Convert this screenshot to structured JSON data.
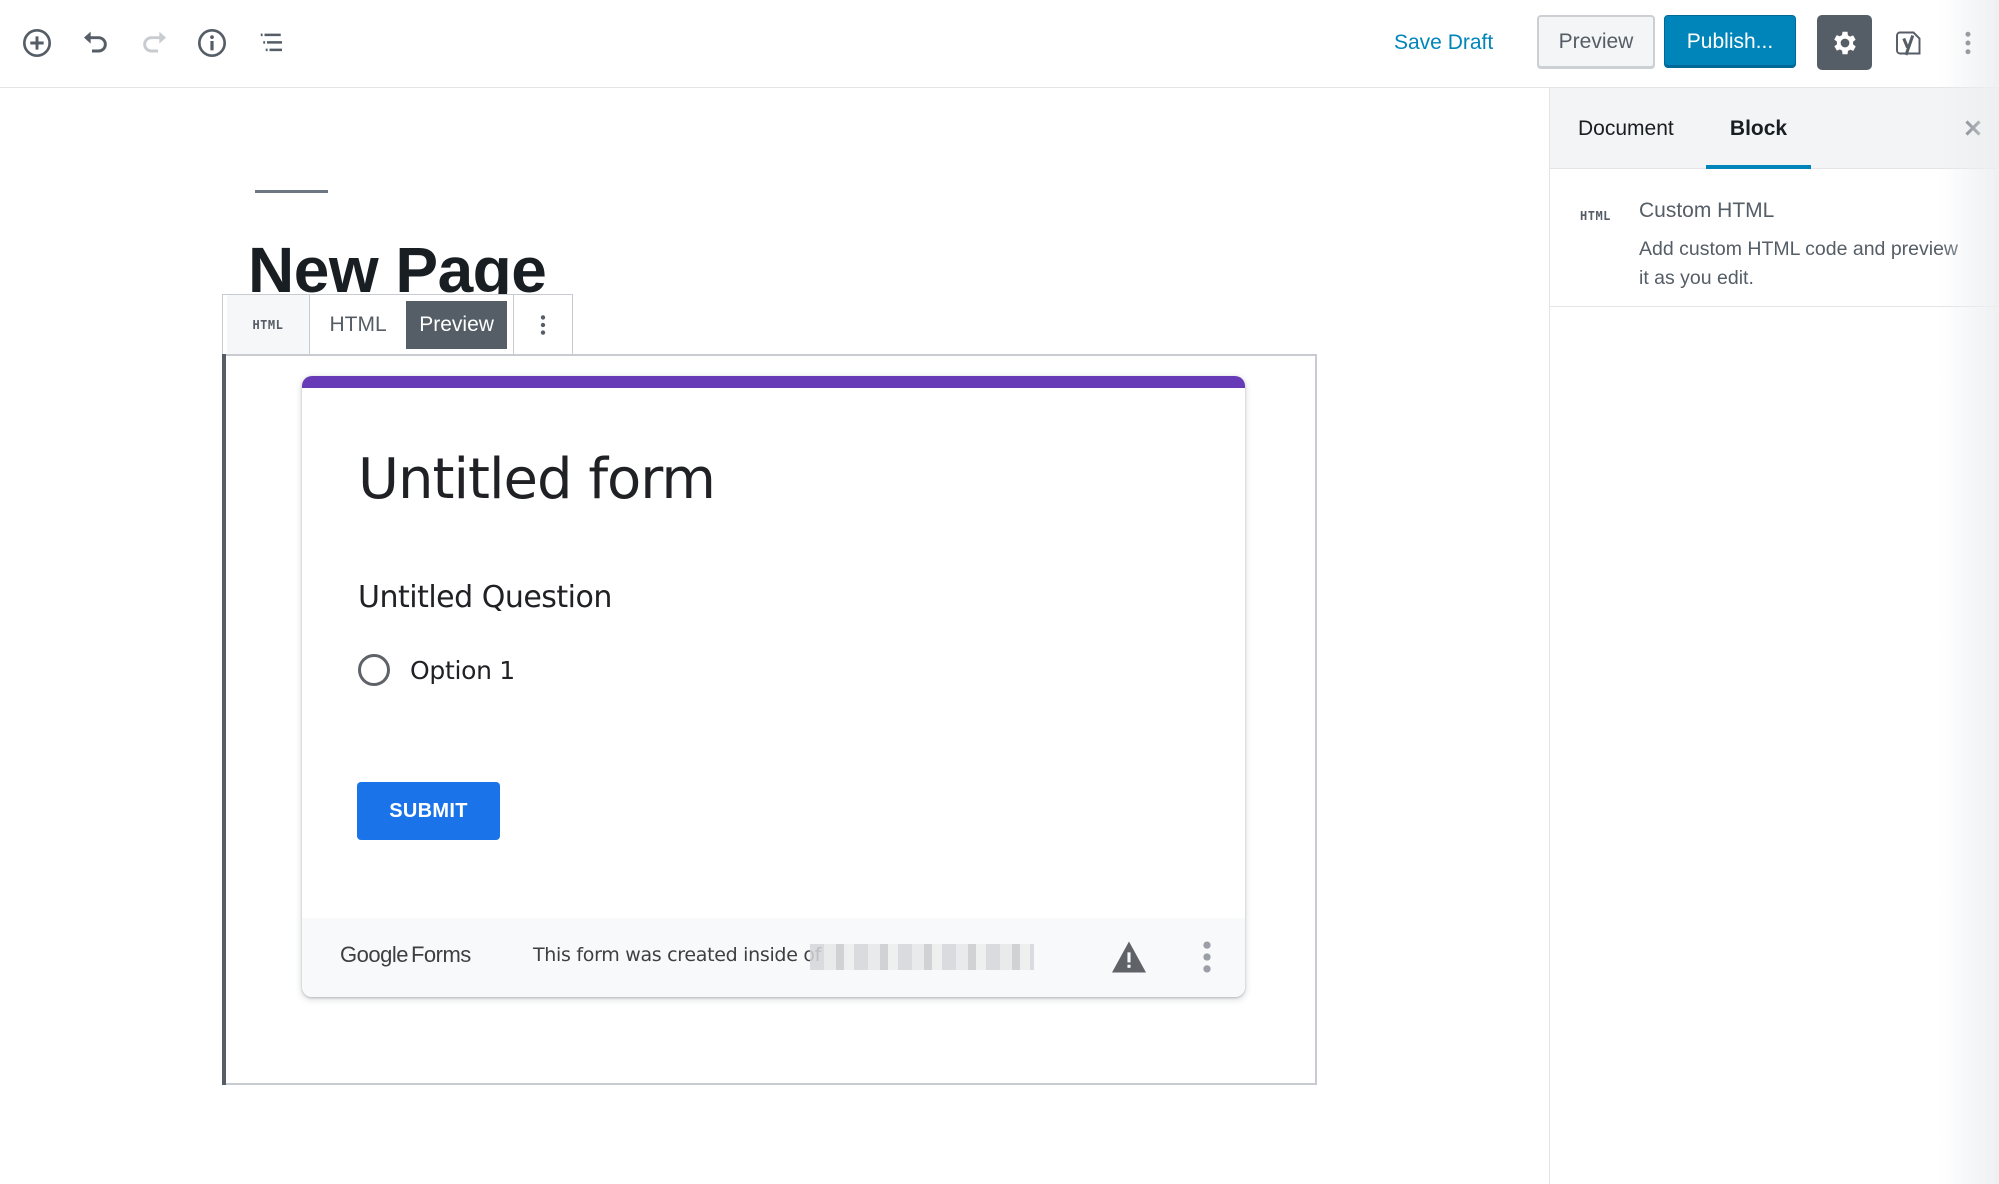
{
  "header": {
    "toolbar_icons": [
      {
        "name": "add-block-icon",
        "label": "Add block"
      },
      {
        "name": "undo-icon",
        "label": "Undo"
      },
      {
        "name": "redo-icon",
        "label": "Redo",
        "disabled": true
      },
      {
        "name": "info-icon",
        "label": "Content structure"
      },
      {
        "name": "block-navigation-icon",
        "label": "Block navigation"
      }
    ],
    "save_draft_label": "Save Draft",
    "preview_label": "Preview",
    "publish_label": "Publish...",
    "settings_icon": "gear-icon",
    "yoast_icon": "yoast-icon",
    "more_icon": "more-vertical-icon"
  },
  "editor": {
    "post_title": "New Page",
    "block_toolbar": {
      "block_type_label": "HTML",
      "tabs": [
        {
          "label": "HTML",
          "active": false
        },
        {
          "label": "Preview",
          "active": true
        }
      ],
      "more_icon": "more-vertical-icon"
    }
  },
  "form": {
    "accent_color": "#673ab7",
    "title": "Untitled form",
    "question": "Untitled Question",
    "options": [
      "Option 1"
    ],
    "submit_label": "SUBMIT",
    "footer": {
      "logo_google": "Google",
      "logo_forms": "Forms",
      "notice": "This form was created inside of",
      "warning_icon": "warning-icon",
      "more_icon": "more-vertical-icon"
    }
  },
  "sidebar": {
    "tabs": [
      {
        "label": "Document",
        "active": false
      },
      {
        "label": "Block",
        "active": true
      }
    ],
    "close_icon": "close-icon",
    "block_card": {
      "icon_label": "HTML",
      "title": "Custom HTML",
      "description": "Add custom HTML code and preview it as you edit."
    }
  },
  "colors": {
    "primary": "#0085ba",
    "toolbar_dark": "#555d66",
    "submit_blue": "#1a73e8"
  }
}
